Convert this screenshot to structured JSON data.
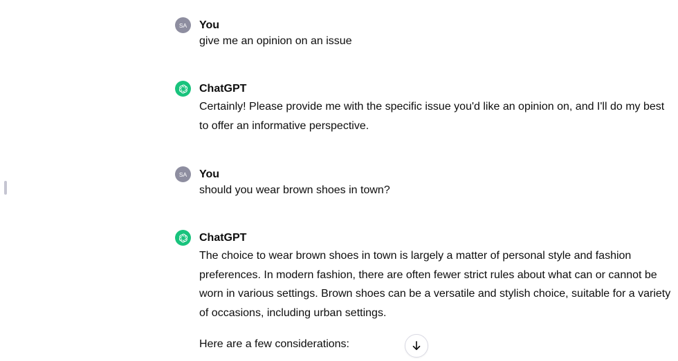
{
  "conversation": {
    "messages": [
      {
        "author": "You",
        "avatar_initials": "SA",
        "paragraphs": [
          "give me an opinion on an issue"
        ]
      },
      {
        "author": "ChatGPT",
        "avatar_icon": "openai-logo-icon",
        "paragraphs": [
          "Certainly! Please provide me with the specific issue you'd like an opinion on, and I'll do my best to offer an informative perspective."
        ]
      },
      {
        "author": "You",
        "avatar_initials": "SA",
        "paragraphs": [
          "should you wear brown shoes in town?"
        ]
      },
      {
        "author": "ChatGPT",
        "avatar_icon": "openai-logo-icon",
        "paragraphs": [
          "The choice to wear brown shoes in town is largely a matter of personal style and fashion preferences. In modern fashion, there are often fewer strict rules about what can or cannot be worn in various settings. Brown shoes can be a versatile and stylish choice, suitable for a variety of occasions, including urban settings.",
          "Here are a few considerations:"
        ]
      }
    ]
  },
  "controls": {
    "scroll_down_icon": "arrow-down-icon"
  },
  "colors": {
    "user_avatar_bg": "#8e8ea0",
    "bot_avatar_bg": "#19c37d",
    "text": "#0d0d0d"
  }
}
